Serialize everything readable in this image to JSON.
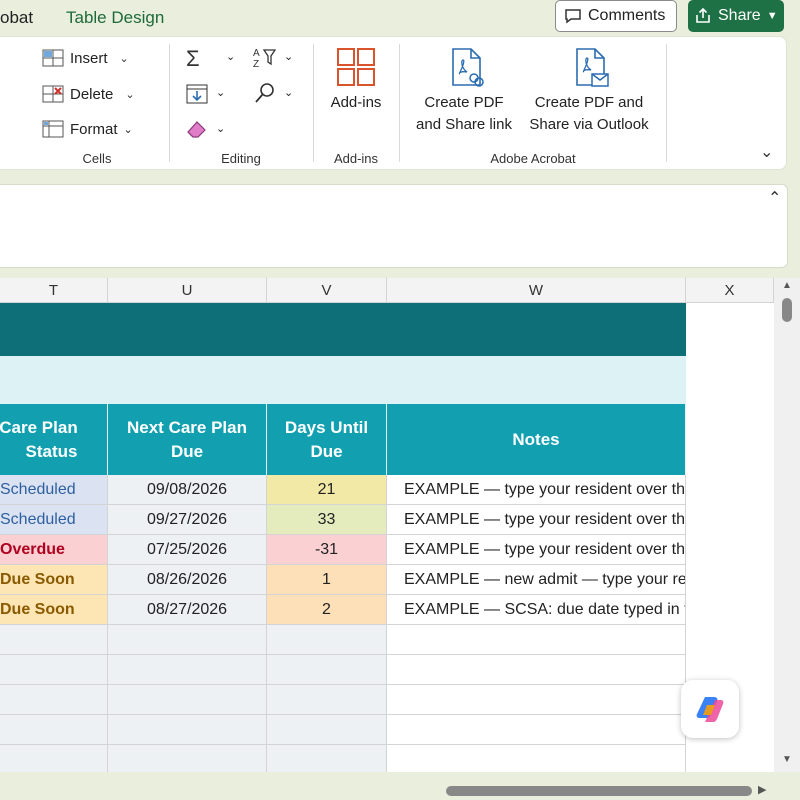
{
  "tabs": {
    "partial_tab": "obat",
    "table_design": "Table Design"
  },
  "header_actions": {
    "comments": "Comments",
    "share": "Share"
  },
  "ribbon": {
    "cells_group": {
      "insert": "Insert",
      "delete": "Delete",
      "format": "Format",
      "label": "Cells"
    },
    "editing_group": {
      "label": "Editing"
    },
    "addins_group": {
      "addins_button": "Add-ins",
      "label": "Add-ins"
    },
    "acrobat_group": {
      "create_pdf_share_link_line1": "Create PDF",
      "create_pdf_share_link_line2": "and Share link",
      "create_pdf_outlook_line1": "Create PDF and",
      "create_pdf_outlook_line2": "Share via Outlook",
      "label": "Adobe Acrobat"
    }
  },
  "grid": {
    "columns": [
      "T",
      "U",
      "V",
      "W",
      "X"
    ],
    "header": {
      "t_line1": "Care Plan",
      "t_line2": "Status",
      "u_line1": "Next Care Plan",
      "u_line2": "Due",
      "v_line1": "Days Until",
      "v_line2": "Due",
      "w": "Notes"
    },
    "rows": [
      {
        "status": "Scheduled",
        "due": "09/08/2026",
        "days": "21",
        "notes": "EXAMPLE — type your resident over this row",
        "status_color": "#2d5fa0",
        "status_bg": "#dbe3f3",
        "days_bg": "#f3e9a6"
      },
      {
        "status": "Scheduled",
        "due": "09/27/2026",
        "days": "33",
        "notes": "EXAMPLE — type your resident over this row",
        "status_color": "#2d5fa0",
        "status_bg": "#dbe3f3",
        "days_bg": "#e4ecbe"
      },
      {
        "status": "Overdue",
        "due": "07/25/2026",
        "days": "-31",
        "notes": "EXAMPLE — type your resident over this row",
        "status_color": "#b00020",
        "status_bg": "#fbd0d3",
        "days_bg": "#fbd0d3"
      },
      {
        "status": "Due Soon",
        "due": "08/26/2026",
        "days": "1",
        "notes": "EXAMPLE — new admit — type your resident",
        "status_color": "#8a5a00",
        "status_bg": "#fde6b3",
        "days_bg": "#fde0b8"
      },
      {
        "status": "Due Soon",
        "due": "08/27/2026",
        "days": "2",
        "notes": "EXAMPLE — SCSA: due date typed in the Ov",
        "status_color": "#8a5a00",
        "status_bg": "#fde6b3",
        "days_bg": "#fde0b8"
      }
    ]
  },
  "colors": {
    "accent_green": "#1e7145",
    "banner_dark": "#0e6f78",
    "banner_light": "#ddf2f5",
    "header_teal": "#12a0b0"
  }
}
